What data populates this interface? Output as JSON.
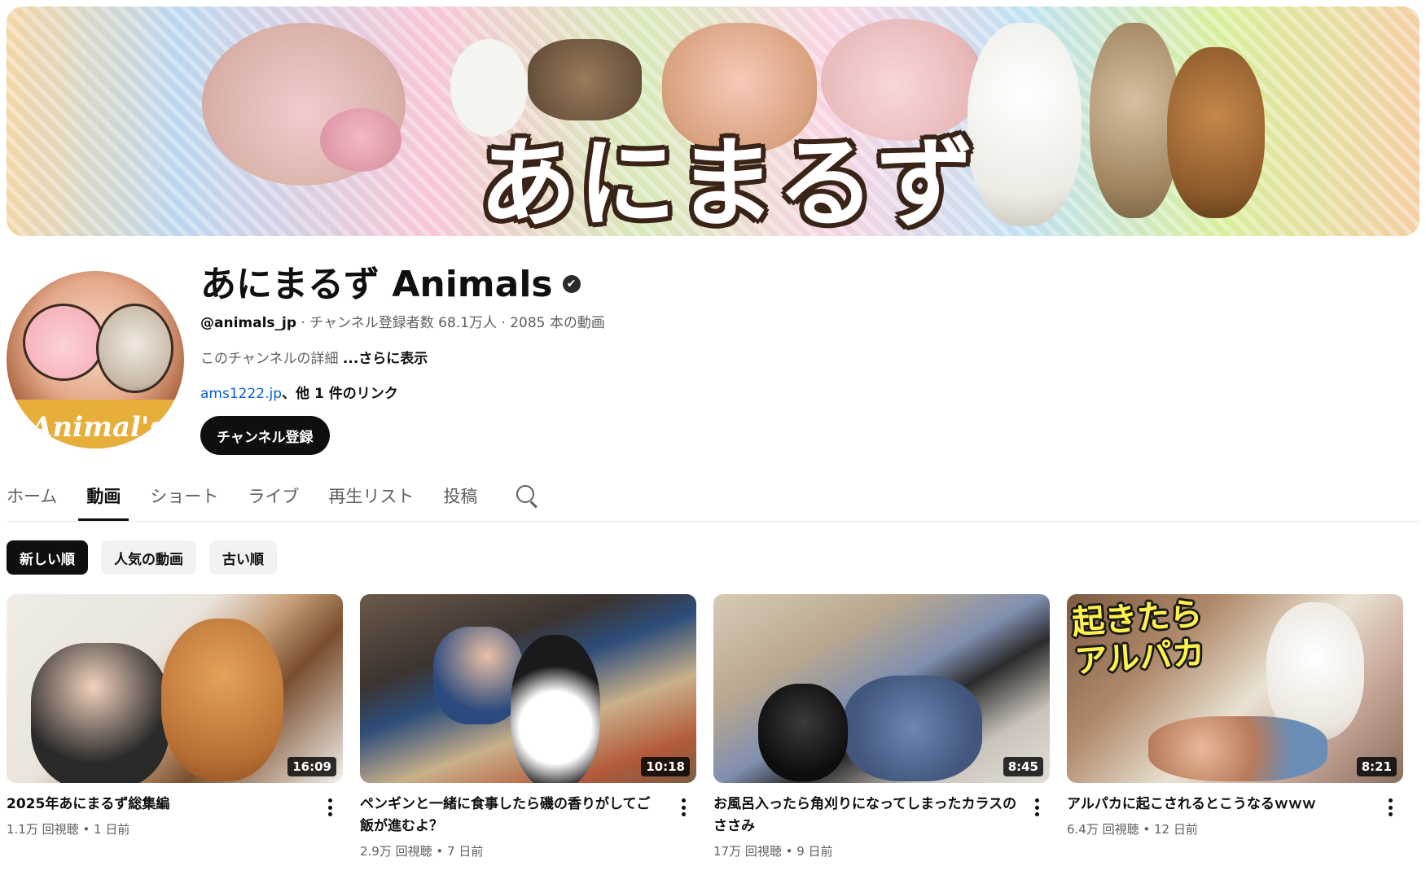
{
  "channel": {
    "name": "あにまるず Animals",
    "verified_glyph": "✔",
    "handle": "@animals_jp",
    "stats": " · チャンネル登録者数 68.1万人 · 2085 本の動画",
    "about": "このチャンネルの詳細 ",
    "about_more": "...さらに表示",
    "link": "ams1222.jp",
    "link_other": "、他 1 件のリンク",
    "subscribe_label": "チャンネル登録",
    "avatar_text": "Animal's"
  },
  "banner": {
    "title_art": "あにまるず"
  },
  "tabs": [
    {
      "label": "ホーム",
      "active": false
    },
    {
      "label": "動画",
      "active": true
    },
    {
      "label": "ショート",
      "active": false
    },
    {
      "label": "ライブ",
      "active": false
    },
    {
      "label": "再生リスト",
      "active": false
    },
    {
      "label": "投稿",
      "active": false
    }
  ],
  "tab_search_icon": "search-icon",
  "chips": [
    {
      "label": "新しい順",
      "active": true
    },
    {
      "label": "人気の動画",
      "active": false
    },
    {
      "label": "古い順",
      "active": false
    }
  ],
  "videos": [
    {
      "title": "2025年あにまるず総集編",
      "stats": "1.1万 回視聴 • 1 日前",
      "duration": "16:09",
      "overlay": ""
    },
    {
      "title": "ペンギンと一緒に食事したら磯の香りがしてご飯が進むよ？",
      "stats": "2.9万 回視聴 • 7 日前",
      "duration": "10:18",
      "overlay": ""
    },
    {
      "title": "お風呂入ったら角刈りになってしまったカラスのささみ",
      "stats": "17万 回視聴 • 9 日前",
      "duration": "8:45",
      "overlay": ""
    },
    {
      "title": "アルパカに起こされるとこうなるｗｗｗ",
      "stats": "6.4万 回視聴 • 12 日前",
      "duration": "8:21",
      "overlay": "起きたら\nアルパカ"
    }
  ],
  "colors": {
    "text_primary": "#0f0f0f",
    "text_secondary": "#606060",
    "link": "#065fd4",
    "chip_bg": "#f2f2f2"
  }
}
